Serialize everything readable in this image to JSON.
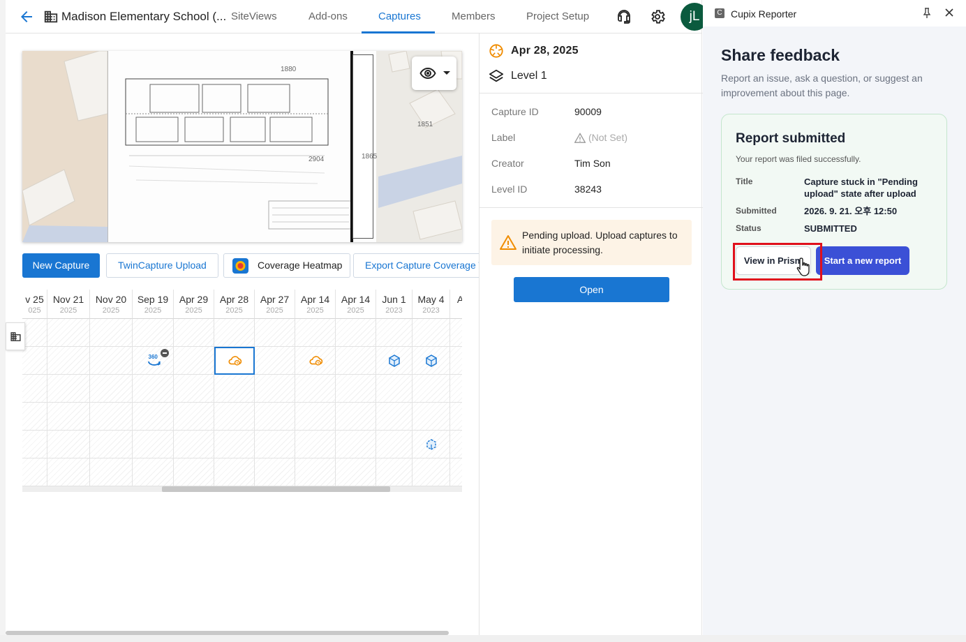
{
  "app": {
    "project_title": "Madison Elementary School (...",
    "tabs": [
      {
        "label": "SiteViews"
      },
      {
        "label": "Add-ons"
      },
      {
        "label": "Captures"
      },
      {
        "label": "Members"
      },
      {
        "label": "Project Setup"
      }
    ],
    "active_tab": "Captures",
    "avatar_initials": "jL",
    "accent_color": "#1976d2"
  },
  "map": {
    "labels": [
      "1880",
      "1851",
      "1865",
      "2904"
    ]
  },
  "actions": {
    "new_capture": "New Capture",
    "twincapture_upload": "TwinCapture Upload",
    "coverage_heatmap": "Coverage Heatmap",
    "export_capture_coverage": "Export Capture Coverage T"
  },
  "timeline": {
    "columns": [
      {
        "date": "v 25",
        "year": "025"
      },
      {
        "date": "Nov 21",
        "year": "2025"
      },
      {
        "date": "Nov 20",
        "year": "2025"
      },
      {
        "date": "Sep 19",
        "year": "2025"
      },
      {
        "date": "Apr 29",
        "year": "2025"
      },
      {
        "date": "Apr 28",
        "year": "2025"
      },
      {
        "date": "Apr 27",
        "year": "2025"
      },
      {
        "date": "Apr 14",
        "year": "2025"
      },
      {
        "date": "Apr 14",
        "year": "2025"
      },
      {
        "date": "Jun 1",
        "year": "2023"
      },
      {
        "date": "May 4",
        "year": "2023"
      },
      {
        "date": "A",
        "year": ""
      }
    ],
    "icon_360_text": "360"
  },
  "details": {
    "date": "Apr 28, 2025",
    "level": "Level 1",
    "rows": [
      {
        "label": "Capture ID",
        "value": "90009"
      },
      {
        "label": "Label",
        "value": "(Not Set)"
      },
      {
        "label": "Creator",
        "value": "Tim Son"
      },
      {
        "label": "Level ID",
        "value": "38243"
      }
    ],
    "alert_text": "Pending upload. Upload captures to initiate processing.",
    "open_button": "Open",
    "alert_color": "#f08c00"
  },
  "reporter": {
    "app_name": "Cupix Reporter",
    "logo_letter": "C",
    "heading": "Share feedback",
    "subheading": "Report an issue, ask a question, or suggest an improvement about this page.",
    "card": {
      "title": "Report submitted",
      "note": "Your report was filed successfully.",
      "fields": [
        {
          "label": "Title",
          "value": "Capture stuck in \"Pending upload\" state after upload"
        },
        {
          "label": "Submitted",
          "value": "2026. 9. 21. 오후 12:50"
        },
        {
          "label": "Status",
          "value": "SUBMITTED"
        }
      ],
      "view_button": "View in Prism",
      "new_report_button": "Start a new report"
    }
  }
}
